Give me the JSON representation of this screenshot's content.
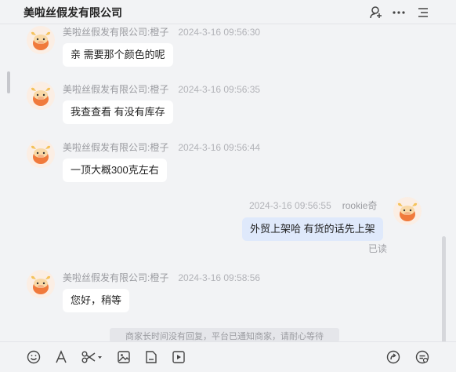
{
  "header": {
    "title": "美啦丝假发有限公司"
  },
  "messages": [
    {
      "sender": "美啦丝假发有限公司:橙子",
      "time": "2024-3-16 09:56:30",
      "text": "亲 需要那个颜色的呢"
    },
    {
      "sender": "美啦丝假发有限公司:橙子",
      "time": "2024-3-16 09:56:35",
      "text": "我查查看 有没有库存"
    },
    {
      "sender": "美啦丝假发有限公司:橙子",
      "time": "2024-3-16 09:56:44",
      "text": "一顶大概300克左右"
    },
    {
      "sender": "rookie奇",
      "time": "2024-3-16 09:56:55",
      "text": "外贸上架哈 有货的话先上架",
      "status": "已读"
    },
    {
      "sender": "美啦丝假发有限公司:橙子",
      "time": "2024-3-16 09:58:56",
      "text": "您好，稍等"
    }
  ],
  "system_notice": "商家长时间没有回复，平台已通知商家，请耐心等待",
  "colors": {
    "background": "#f2f3f5",
    "bubble_incoming": "#ffffff",
    "bubble_outgoing": "#dfe9fb",
    "avatar_accent": "#f07a3c"
  },
  "icons": {
    "header": [
      "add-contact-icon",
      "more-icon",
      "menu-icon"
    ],
    "toolbar": [
      "emoji-icon",
      "font-icon",
      "scissors-icon",
      "image-icon",
      "file-icon",
      "video-icon",
      "share-icon",
      "quick-reply-icon"
    ]
  }
}
